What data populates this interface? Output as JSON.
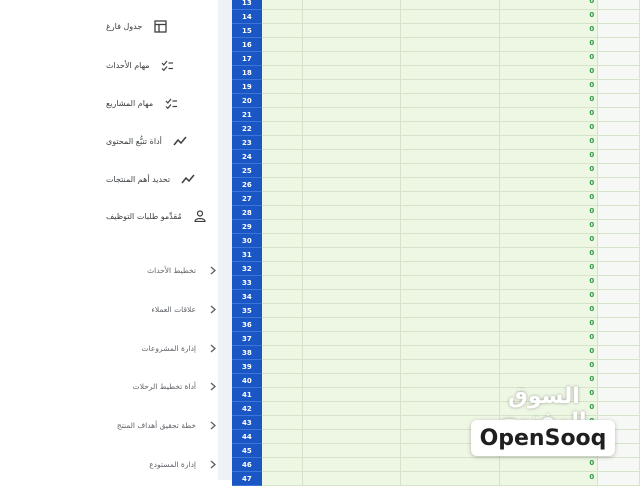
{
  "sidebar": {
    "items": [
      {
        "label": "جدول فارغ",
        "icon": "table-icon"
      },
      {
        "label": "مهام الأحداث",
        "icon": "checklist-icon"
      },
      {
        "label": "مهام المشاريع",
        "icon": "checklist-icon"
      },
      {
        "label": "أداة تتبُّع المحتوى",
        "icon": "trend-icon"
      },
      {
        "label": "تحديد أهم المنتجات",
        "icon": "trend-icon"
      },
      {
        "label": "مُقدِّمو طلبات التوظيف",
        "icon": "person-icon"
      }
    ],
    "groups": [
      {
        "label": "تخطيط الأحداث",
        "icon": "chevron-right-icon"
      },
      {
        "label": "علاقات العملاء",
        "icon": "chevron-right-icon"
      },
      {
        "label": "إدارة المشروعات",
        "icon": "chevron-right-icon"
      },
      {
        "label": "أداة تخطيط الرحلات",
        "icon": "chevron-right-icon"
      },
      {
        "label": "خطة تحقيق أهداف المنتج",
        "icon": "chevron-right-icon"
      },
      {
        "label": "إدارة المستودع",
        "icon": "chevron-right-icon"
      }
    ]
  },
  "sheet": {
    "rows": [
      {
        "num": "13",
        "value": "0"
      },
      {
        "num": "14",
        "value": "0"
      },
      {
        "num": "15",
        "value": "0"
      },
      {
        "num": "16",
        "value": "0"
      },
      {
        "num": "17",
        "value": "0"
      },
      {
        "num": "18",
        "value": "0"
      },
      {
        "num": "19",
        "value": "0"
      },
      {
        "num": "20",
        "value": "0"
      },
      {
        "num": "21",
        "value": "0"
      },
      {
        "num": "22",
        "value": "0"
      },
      {
        "num": "23",
        "value": "0"
      },
      {
        "num": "24",
        "value": "0"
      },
      {
        "num": "25",
        "value": "0"
      },
      {
        "num": "26",
        "value": "0"
      },
      {
        "num": "27",
        "value": "0"
      },
      {
        "num": "28",
        "value": "0"
      },
      {
        "num": "29",
        "value": "0"
      },
      {
        "num": "30",
        "value": "0"
      },
      {
        "num": "31",
        "value": "0"
      },
      {
        "num": "32",
        "value": "0"
      },
      {
        "num": "33",
        "value": "0"
      },
      {
        "num": "34",
        "value": "0"
      },
      {
        "num": "35",
        "value": "0"
      },
      {
        "num": "36",
        "value": "0"
      },
      {
        "num": "37",
        "value": "0"
      },
      {
        "num": "38",
        "value": "0"
      },
      {
        "num": "39",
        "value": "0"
      },
      {
        "num": "40",
        "value": "0"
      },
      {
        "num": "41",
        "value": "0"
      },
      {
        "num": "42",
        "value": "0"
      },
      {
        "num": "43",
        "value": "0"
      },
      {
        "num": "44",
        "value": "0"
      },
      {
        "num": "45",
        "value": "0"
      },
      {
        "num": "46",
        "value": "0"
      },
      {
        "num": "47",
        "value": "0"
      }
    ]
  },
  "watermark": {
    "arabic": "السوق المفتوح",
    "brand": "OpenSooq"
  },
  "colors": {
    "row_header": "#1a56c4",
    "value_green": "#2e9a47",
    "cell_bg": "#eef6e4"
  }
}
